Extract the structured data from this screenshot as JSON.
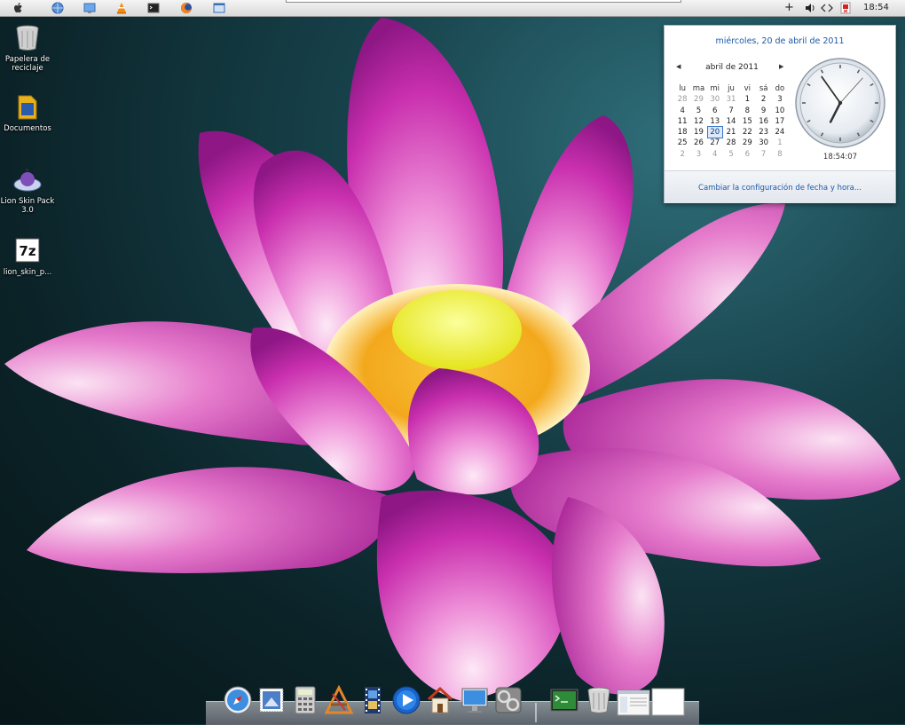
{
  "menubar": {
    "icons": [
      "apple-icon",
      "globe-icon",
      "monitor-icon",
      "vlc-cone-icon",
      "terminal-icon",
      "firefox-icon",
      "finder-window-icon"
    ],
    "status_icons": [
      "plus-icon",
      "volume-icon",
      "network-arrows-icon",
      "flag-icon"
    ],
    "time": "18:54"
  },
  "desktop": {
    "icons": [
      {
        "label": "Papelera de reciclaje",
        "icon": "trash-can-icon"
      },
      {
        "label": "Documentos",
        "icon": "folder-icon"
      },
      {
        "label": "Lion Skin Pack 3.0",
        "icon": "lion-disc-icon"
      },
      {
        "label": "lion_skin_p...",
        "icon": "7zip-archive-icon"
      }
    ]
  },
  "datetime_popup": {
    "long_date": "miércoles, 20 de abril de 2011",
    "month_label": "abril de 2011",
    "weekdays": [
      "lu",
      "ma",
      "mi",
      "ju",
      "vi",
      "sá",
      "do"
    ],
    "weeks": [
      [
        "28",
        "29",
        "30",
        "31",
        "1",
        "2",
        "3"
      ],
      [
        "4",
        "5",
        "6",
        "7",
        "8",
        "9",
        "10"
      ],
      [
        "11",
        "12",
        "13",
        "14",
        "15",
        "16",
        "17"
      ],
      [
        "18",
        "19",
        "20",
        "21",
        "22",
        "23",
        "24"
      ],
      [
        "25",
        "26",
        "27",
        "28",
        "29",
        "30",
        "1"
      ],
      [
        "2",
        "3",
        "4",
        "5",
        "6",
        "7",
        "8"
      ]
    ],
    "today": "20",
    "clock_time": "18:54:07",
    "change_link": "Cambiar la configuración de fecha y hora..."
  },
  "dock": {
    "items": [
      "safari-compass-icon",
      "mail-stamp-icon",
      "calculator-icon",
      "app-store-icon",
      "film-strip-icon",
      "quicktime-play-icon",
      "home-icon",
      "display-monitor-icon",
      "system-preferences-icon",
      "spacer",
      "terminal-green-icon",
      "dock-trash-icon",
      "finder-preview-icon",
      "blank-window-icon"
    ]
  },
  "colors": {
    "link_blue": "#1e5aa8",
    "today_border": "#3a78c8",
    "petal_pink": "#d23ab6"
  }
}
